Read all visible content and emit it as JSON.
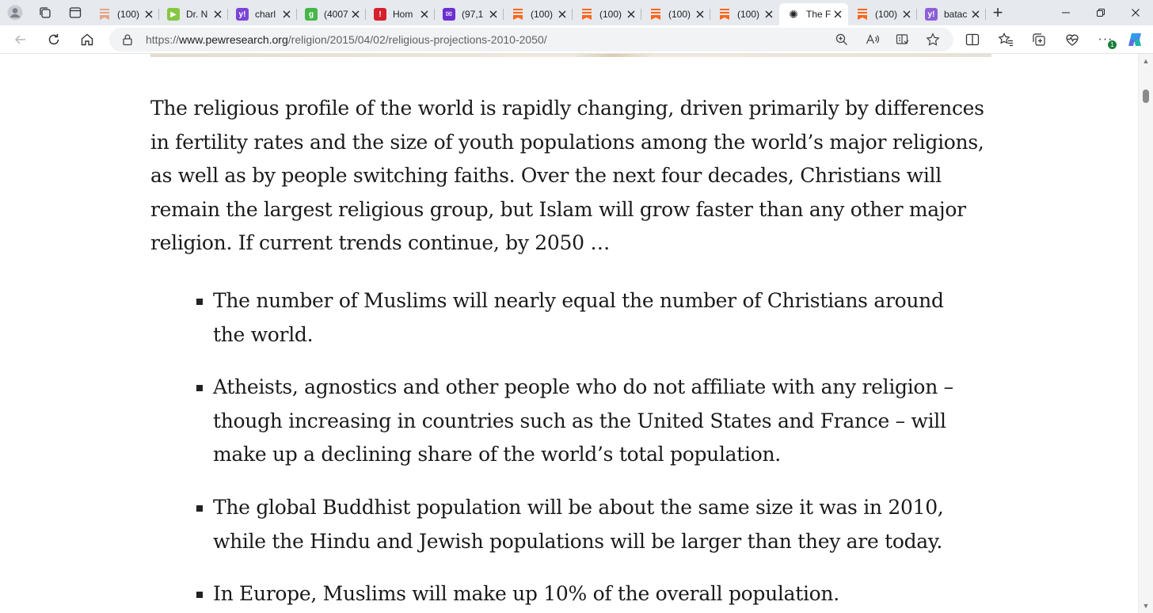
{
  "browser": {
    "tabs": [
      {
        "title": "(100)",
        "icon": "substack-pale-icon",
        "color": "#e5a588",
        "glyph": ""
      },
      {
        "title": "Dr. N",
        "icon": "rumble-icon",
        "color": "#85c742",
        "glyph": "▶"
      },
      {
        "title": "charl",
        "icon": "yahoo-icon",
        "color": "#7b45d6",
        "glyph": "y!"
      },
      {
        "title": "(4007",
        "icon": "gettr-icon",
        "color": "#46b649",
        "glyph": "g"
      },
      {
        "title": "Hom",
        "icon": "truth-social-icon",
        "color": "#d6202c",
        "glyph": "!"
      },
      {
        "title": "(97,1",
        "icon": "yahoo-mail-icon",
        "color": "#6b2fd1",
        "glyph": "✉"
      },
      {
        "title": "(100)",
        "icon": "substack-icon",
        "color": "#ff6719",
        "glyph": ""
      },
      {
        "title": "(100)",
        "icon": "substack-icon",
        "color": "#ff6719",
        "glyph": ""
      },
      {
        "title": "(100)",
        "icon": "substack-icon",
        "color": "#ff6719",
        "glyph": ""
      },
      {
        "title": "(100)",
        "icon": "substack-icon",
        "color": "#ff6719",
        "glyph": ""
      },
      {
        "title": "The F",
        "icon": "pew-research-icon",
        "color": "#ffffff",
        "glyph": "✺",
        "active": true
      },
      {
        "title": "(100)",
        "icon": "substack-icon",
        "color": "#ff6719",
        "glyph": ""
      },
      {
        "title": "batac",
        "icon": "yahoo-icon",
        "color": "#8e5fd6",
        "glyph": "y!"
      }
    ],
    "url_scheme": "https://",
    "url_host": "www.pewresearch.org",
    "url_path": "/religion/2015/04/02/religious-projections-2010-2050/",
    "notification_badge": "1"
  },
  "article": {
    "lead": "The religious profile of the world is rapidly changing, driven primarily by differences in fertility rates and the size of youth populations among the world’s major religions, as well as by people switching faiths. Over the next four decades, Christians will remain the largest religious group, but Islam will grow faster than any other major religion. If current trends continue, by 2050 …",
    "bullets": [
      "The number of Muslims will nearly equal the number of Christians around the world.",
      "Atheists, agnostics and other people who do not affiliate with any religion – though increasing in countries such as the United States and France – will make up a declining share of the world’s total population.",
      "The global Buddhist population will be about the same size it was in 2010, while the Hindu and Jewish populations will be larger than they are today.",
      "In Europe, Muslims will make up 10% of the overall population."
    ]
  }
}
